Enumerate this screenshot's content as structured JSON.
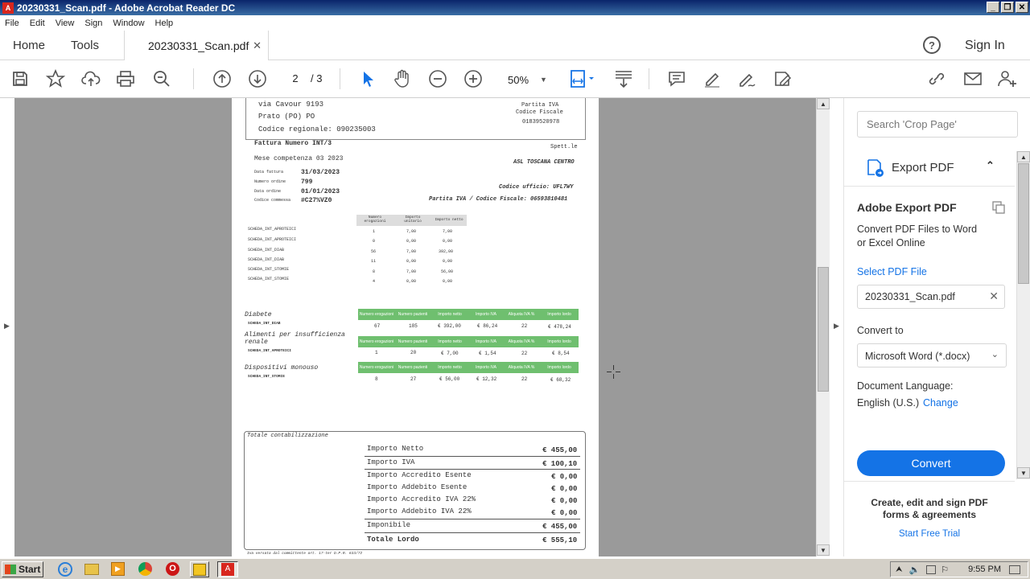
{
  "window": {
    "title": "20230331_Scan.pdf - Adobe Acrobat Reader DC"
  },
  "menu": [
    "File",
    "Edit",
    "View",
    "Sign",
    "Window",
    "Help"
  ],
  "nav": {
    "home": "Home",
    "tools": "Tools",
    "doc_tab": "20230331_Scan.pdf",
    "sign_in": "Sign In"
  },
  "toolbar": {
    "page_current": "2",
    "page_total": "/ 3",
    "zoom": "50%"
  },
  "invoice": {
    "addr1": "via Cavour 9193",
    "addr2": "Prato (PO) PO",
    "addr3": "Codice regionale: 090235003",
    "piva_label": "Partita IVA",
    "cf_label": "Codice Fiscale",
    "piva_num": "01839520978",
    "fattura": "Fattura Numero INT/3",
    "mese": "Mese competenza  03 2023",
    "spett": "Spett.le",
    "asl": "ASL TOSCANA CENTRO",
    "meta": [
      {
        "k": "Data fattura",
        "v": "31/03/2023"
      },
      {
        "k": "Numero ordine",
        "v": "799"
      },
      {
        "k": "Data ordine",
        "v": "01/01/2023"
      },
      {
        "k": "Codice commessa",
        "v": "#C27%VZ0"
      }
    ],
    "ufficio": "Codice ufficio: UFL7WY",
    "piva_cf": "Partita IVA / Codice Fiscale: 06593810481",
    "small_headers": [
      "Numero erogazioni",
      "Importo unitario",
      "Importo netto"
    ],
    "small_rows": [
      {
        "name": "SCHEDA_INT_APROTEICI",
        "n": "1",
        "u": "7,00",
        "t": "7,00"
      },
      {
        "name": "SCHEDA_INT_APROTEICI",
        "n": "0",
        "u": "0,00",
        "t": "0,00"
      },
      {
        "name": "SCHEDA_INT_DIAB",
        "n": "56",
        "u": "7,00",
        "t": "392,00"
      },
      {
        "name": "SCHEDA_INT_DIAB",
        "n": "11",
        "u": "0,00",
        "t": "0,00"
      },
      {
        "name": "SCHEDA_INT_STOMIE",
        "n": "8",
        "u": "7,00",
        "t": "56,00"
      },
      {
        "name": "SCHEDA_INT_STOMIE",
        "n": "4",
        "u": "0,00",
        "t": "0,00"
      }
    ],
    "group_headers": [
      "Numero erogazioni",
      "Numero pazienti",
      "Importo netto",
      "Importo IVA",
      "Aliquota IVA %",
      "Importo lordo"
    ],
    "groups": [
      {
        "title": "Diabete",
        "code": "SCHEDA_INT_DIAB",
        "vals": [
          "67",
          "185",
          "€ 392,00",
          "€ 86,24",
          "22",
          "€ 478,24"
        ]
      },
      {
        "title": "Alimenti per insufficienza renale",
        "code": "SCHEDA_INT_APROTEICI",
        "vals": [
          "1",
          "20",
          "€ 7,00",
          "€ 1,54",
          "22",
          "€ 8,54"
        ]
      },
      {
        "title": "Dispositivi monouso",
        "code": "SCHEDA_INT_STOMIE",
        "vals": [
          "8",
          "27",
          "€ 56,00",
          "€ 12,32",
          "22",
          "€ 68,32"
        ]
      }
    ],
    "totale_title": "Totale contabilizzazione",
    "totals": [
      {
        "k": "Importo Netto",
        "v": "€ 455,00"
      },
      {
        "k": "Importo IVA",
        "v": "€ 100,10"
      },
      {
        "k": "Importo Accredito Esente",
        "v": "€ 0,00"
      },
      {
        "k": "Importo Addebito Esente",
        "v": "€ 0,00"
      },
      {
        "k": "Importo Accredito IVA 22%",
        "v": "€ 0,00"
      },
      {
        "k": "Importo Addebito IVA 22%",
        "v": "€ 0,00"
      },
      {
        "k": "Imponibile",
        "v": "€ 455,00"
      },
      {
        "k": "Totale Lordo",
        "v": "€ 555,10"
      }
    ],
    "footer": "Iva versata dal committente art. 17-ter D.P.R. 633/72"
  },
  "panel": {
    "search_placeholder": "Search 'Crop Page'",
    "export_title": "Export PDF",
    "adobe_export": "Adobe Export PDF",
    "convert_desc1": "Convert PDF Files to Word",
    "convert_desc2": "or Excel Online",
    "select_file": "Select PDF File",
    "file_name": "20230331_Scan.pdf",
    "convert_to": "Convert to",
    "format": "Microsoft Word (*.docx)",
    "doc_lang": "Document Language:",
    "lang": "English (U.S.)",
    "change": "Change",
    "convert_btn": "Convert",
    "promo1": "Create, edit and sign PDF",
    "promo2": "forms & agreements",
    "trial": "Start Free Trial"
  },
  "taskbar": {
    "start": "Start",
    "clock": "9:55 PM"
  },
  "colors": {
    "accent_blue": "#1473e6",
    "acrobat_red": "#d8261d",
    "title_bar": "#0a246a",
    "invoice_green": "#6fbf6f"
  }
}
